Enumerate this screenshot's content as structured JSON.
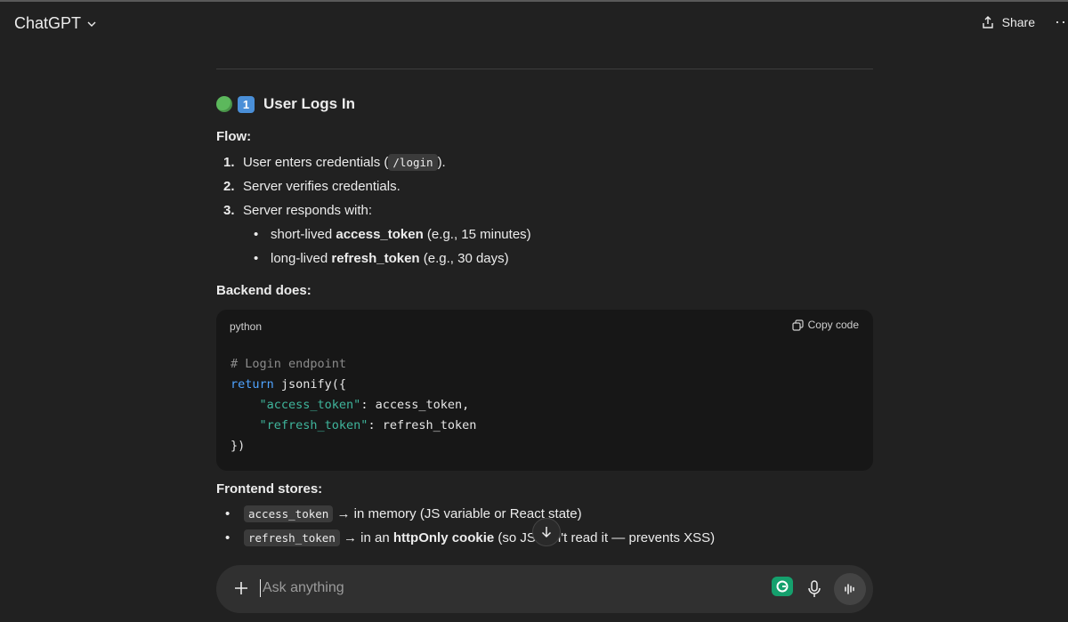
{
  "header": {
    "model_name": "ChatGPT",
    "share_label": "Share",
    "more_label": "···"
  },
  "section": {
    "heading_emoji": "1",
    "heading_text": "User Logs In",
    "flow_label": "Flow:",
    "flow_steps": [
      {
        "num": "1.",
        "pre": "User enters credentials (",
        "code": "/login",
        "post": ")."
      },
      {
        "num": "2.",
        "text": "Server verifies credentials."
      },
      {
        "num": "3.",
        "text": "Server responds with:"
      }
    ],
    "tokens": [
      {
        "pre": "short-lived ",
        "bold": "access_token",
        "post": " (e.g., 15 minutes)"
      },
      {
        "pre": "long-lived ",
        "bold": "refresh_token",
        "post": " (e.g., 30 days)"
      }
    ],
    "backend_label": "Backend does:",
    "code_block": {
      "language": "python",
      "copy_label": "Copy code",
      "lines": {
        "l1": "# Login endpoint",
        "l2_kw": "return",
        "l2_rest": " jsonify({",
        "l3_str": "\"access_token\"",
        "l3_rest": ": access_token,",
        "l4_str": "\"refresh_token\"",
        "l4_rest": ": refresh_token",
        "l5": "})"
      }
    },
    "frontend_label": "Frontend stores:",
    "frontend_items": [
      {
        "code": "access_token",
        "text": " → in memory (JS variable or React state)"
      },
      {
        "code": "refresh_token",
        "pre": " → in an ",
        "bold": "httpOnly cookie",
        "post": " (so JS can't read it — prevents XSS)"
      }
    ]
  },
  "composer": {
    "placeholder": "Ask anything"
  },
  "colors": {
    "background": "#212121",
    "code_bg": "#171717",
    "composer_bg": "#303030",
    "keyword": "#4fa3ff",
    "string": "#3fb59c"
  }
}
